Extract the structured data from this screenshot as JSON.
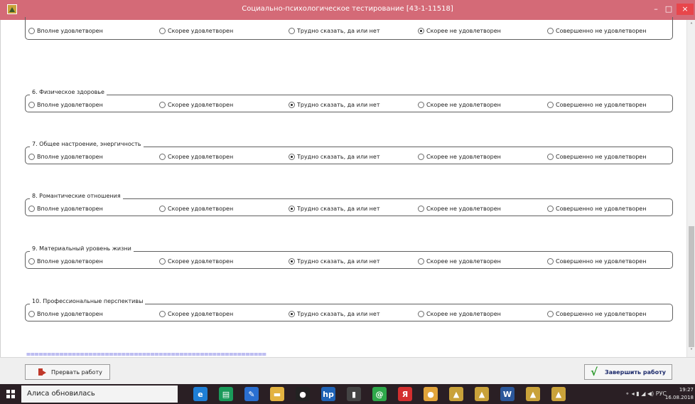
{
  "window": {
    "title": "Социально-психологическое тестирование [43-1-11518]",
    "minimize": "–",
    "maximize": "□",
    "close": "×"
  },
  "options": [
    "Вполне удовлетворен",
    "Скорее удовлетворен",
    "Трудно сказать, да или нет",
    "Скорее не удовлетворен",
    "Совершенно не удовлетворен"
  ],
  "questions": [
    {
      "label": "",
      "selected": 3
    },
    {
      "label": "6. Физическое здоровье",
      "selected": 2
    },
    {
      "label": "7. Общее настроение, энергичность",
      "selected": 2
    },
    {
      "label": "8. Романтические  отношения",
      "selected": 2
    },
    {
      "label": "9. Материальный уровень жизни",
      "selected": 2
    },
    {
      "label": "10. Профессиональные перспективы",
      "selected": 2
    }
  ],
  "divider": "==========================================================",
  "buttons": {
    "abort": "Прервать работу",
    "finish": "Завершить работу"
  },
  "taskbar": {
    "search_text": "Алиса обновилась",
    "language": "РУС",
    "time": "19:27",
    "date": "16.08.2018",
    "icons": [
      "edge-icon",
      "store-icon",
      "feather-icon",
      "folder-icon",
      "media-icon",
      "hp-icon",
      "app-icon",
      "chat-icon",
      "yandex-icon",
      "chrome-icon",
      "test-app-icon",
      "test-app-icon",
      "word-icon",
      "test-app-icon",
      "test-app-icon"
    ]
  }
}
